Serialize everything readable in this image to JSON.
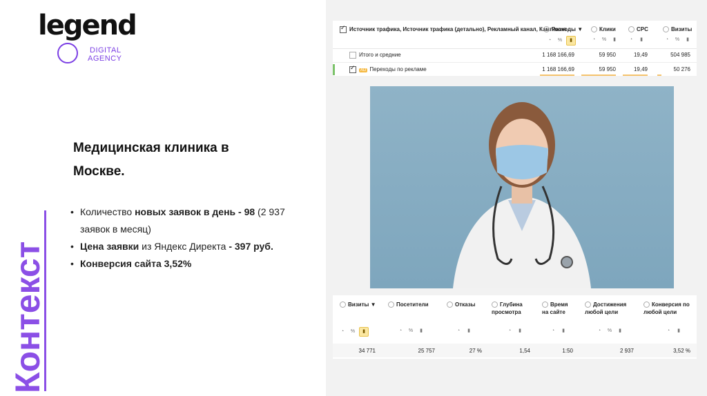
{
  "logo": {
    "word": "legend",
    "line1": "DIGITAL",
    "line2": "AGENCY"
  },
  "slide": {
    "title": "Медицинская клиника в Москве.",
    "vertical": "Контекст",
    "bullets": [
      {
        "a": "Количество ",
        "b": "новых заявок в день - 98",
        "c": " (2 937 заявок в месяц)"
      },
      {
        "a": "",
        "b": "Цена заявки",
        "c": " из Яндекс Директа ",
        "d": "- 397 руб."
      },
      {
        "a": "",
        "b": "Конверсия сайта 3,52%",
        "c": ""
      }
    ]
  },
  "table1": {
    "dimension_header": "Источник трафика, Источник трафика (детально), Рекламный канал, Кампания",
    "columns": [
      "Расходы ▼",
      "Клики",
      "CPC",
      "Визиты"
    ],
    "rows": [
      {
        "label": "Итого и средние",
        "values": [
          "1 168 166,69",
          "59 950",
          "19,49",
          "504 985"
        ]
      },
      {
        "badge": "AD",
        "label": "Переходы по рекламе",
        "values": [
          "1 168 166,69",
          "59 950",
          "19,49",
          "50 276"
        ]
      }
    ]
  },
  "table2": {
    "columns": [
      "Визиты ▼",
      "Посетители",
      "Отказы",
      "Глубина просмотра",
      "Время на сайте",
      "Достижения любой цели",
      "Конверсия по любой цели"
    ],
    "totals": [
      "34 771",
      "25 757",
      "27 %",
      "1,54",
      "1:50",
      "2 937",
      "3,52 %"
    ]
  },
  "icons": {
    "pie": "pie-icon",
    "percent": "percent-icon",
    "bars": "bars-icon"
  },
  "colors": {
    "accent": "#8b4fe6",
    "highlight": "#fbe7a1",
    "bar": "#f5c26b",
    "green": "#7cc36a"
  }
}
